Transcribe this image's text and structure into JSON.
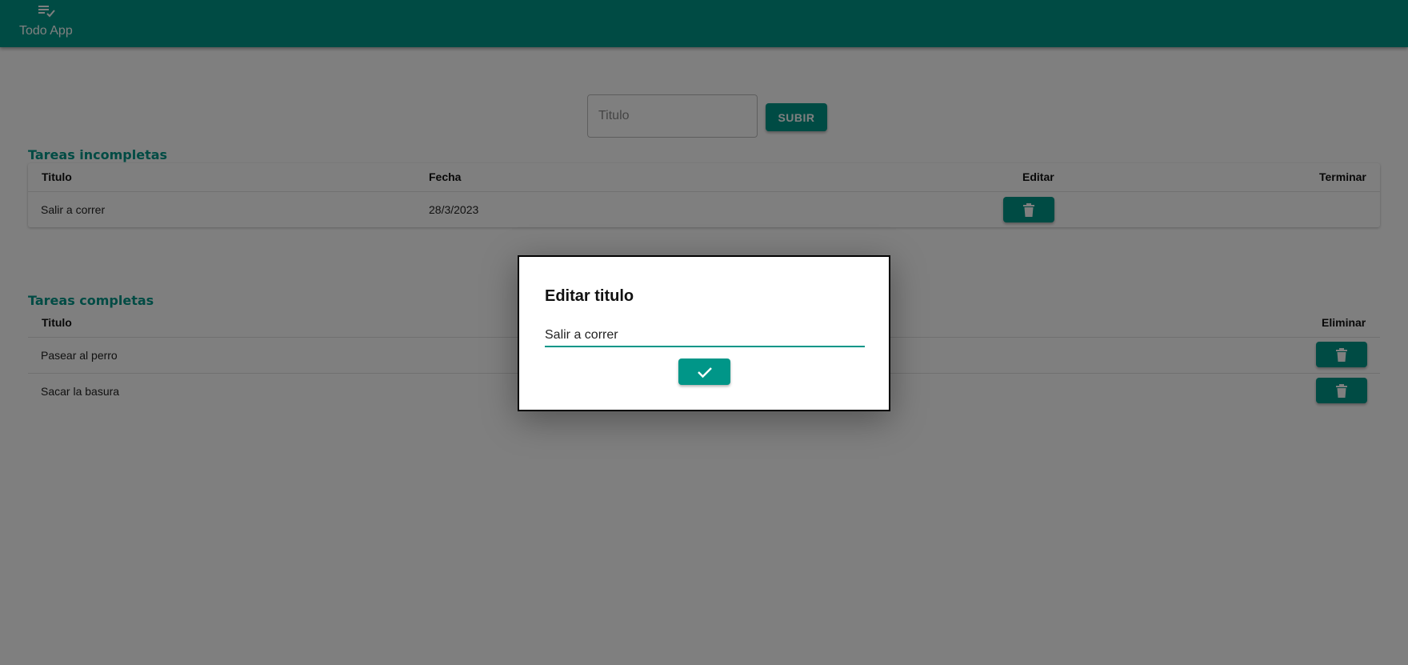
{
  "appbar": {
    "title": "Todo App",
    "icon": "playlist-check-icon",
    "color": "#009688"
  },
  "new_task": {
    "placeholder": "Titulo",
    "value": "",
    "submit_label": "SUBIR"
  },
  "incomplete": {
    "title": "Tareas incompletas",
    "headers": {
      "title": "Titulo",
      "date": "Fecha",
      "edit": "Editar",
      "finish": "Terminar"
    },
    "rows": [
      {
        "title": "Salir a correr",
        "date": "28/3/2023",
        "edit_icon": "trash-icon"
      }
    ]
  },
  "complete": {
    "title": "Tareas completas",
    "headers": {
      "title": "Titulo",
      "delete": "Eliminar"
    },
    "rows": [
      {
        "title": "Pasear al perro",
        "delete_icon": "trash-icon"
      },
      {
        "title": "Sacar la basura",
        "delete_icon": "trash-icon"
      }
    ]
  },
  "dialog": {
    "title": "Editar titulo",
    "value": "Salir a correr",
    "confirm_icon": "check-icon"
  },
  "colors": {
    "accent": "#009688",
    "overlay": "rgba(0,0,0,0.5)"
  }
}
